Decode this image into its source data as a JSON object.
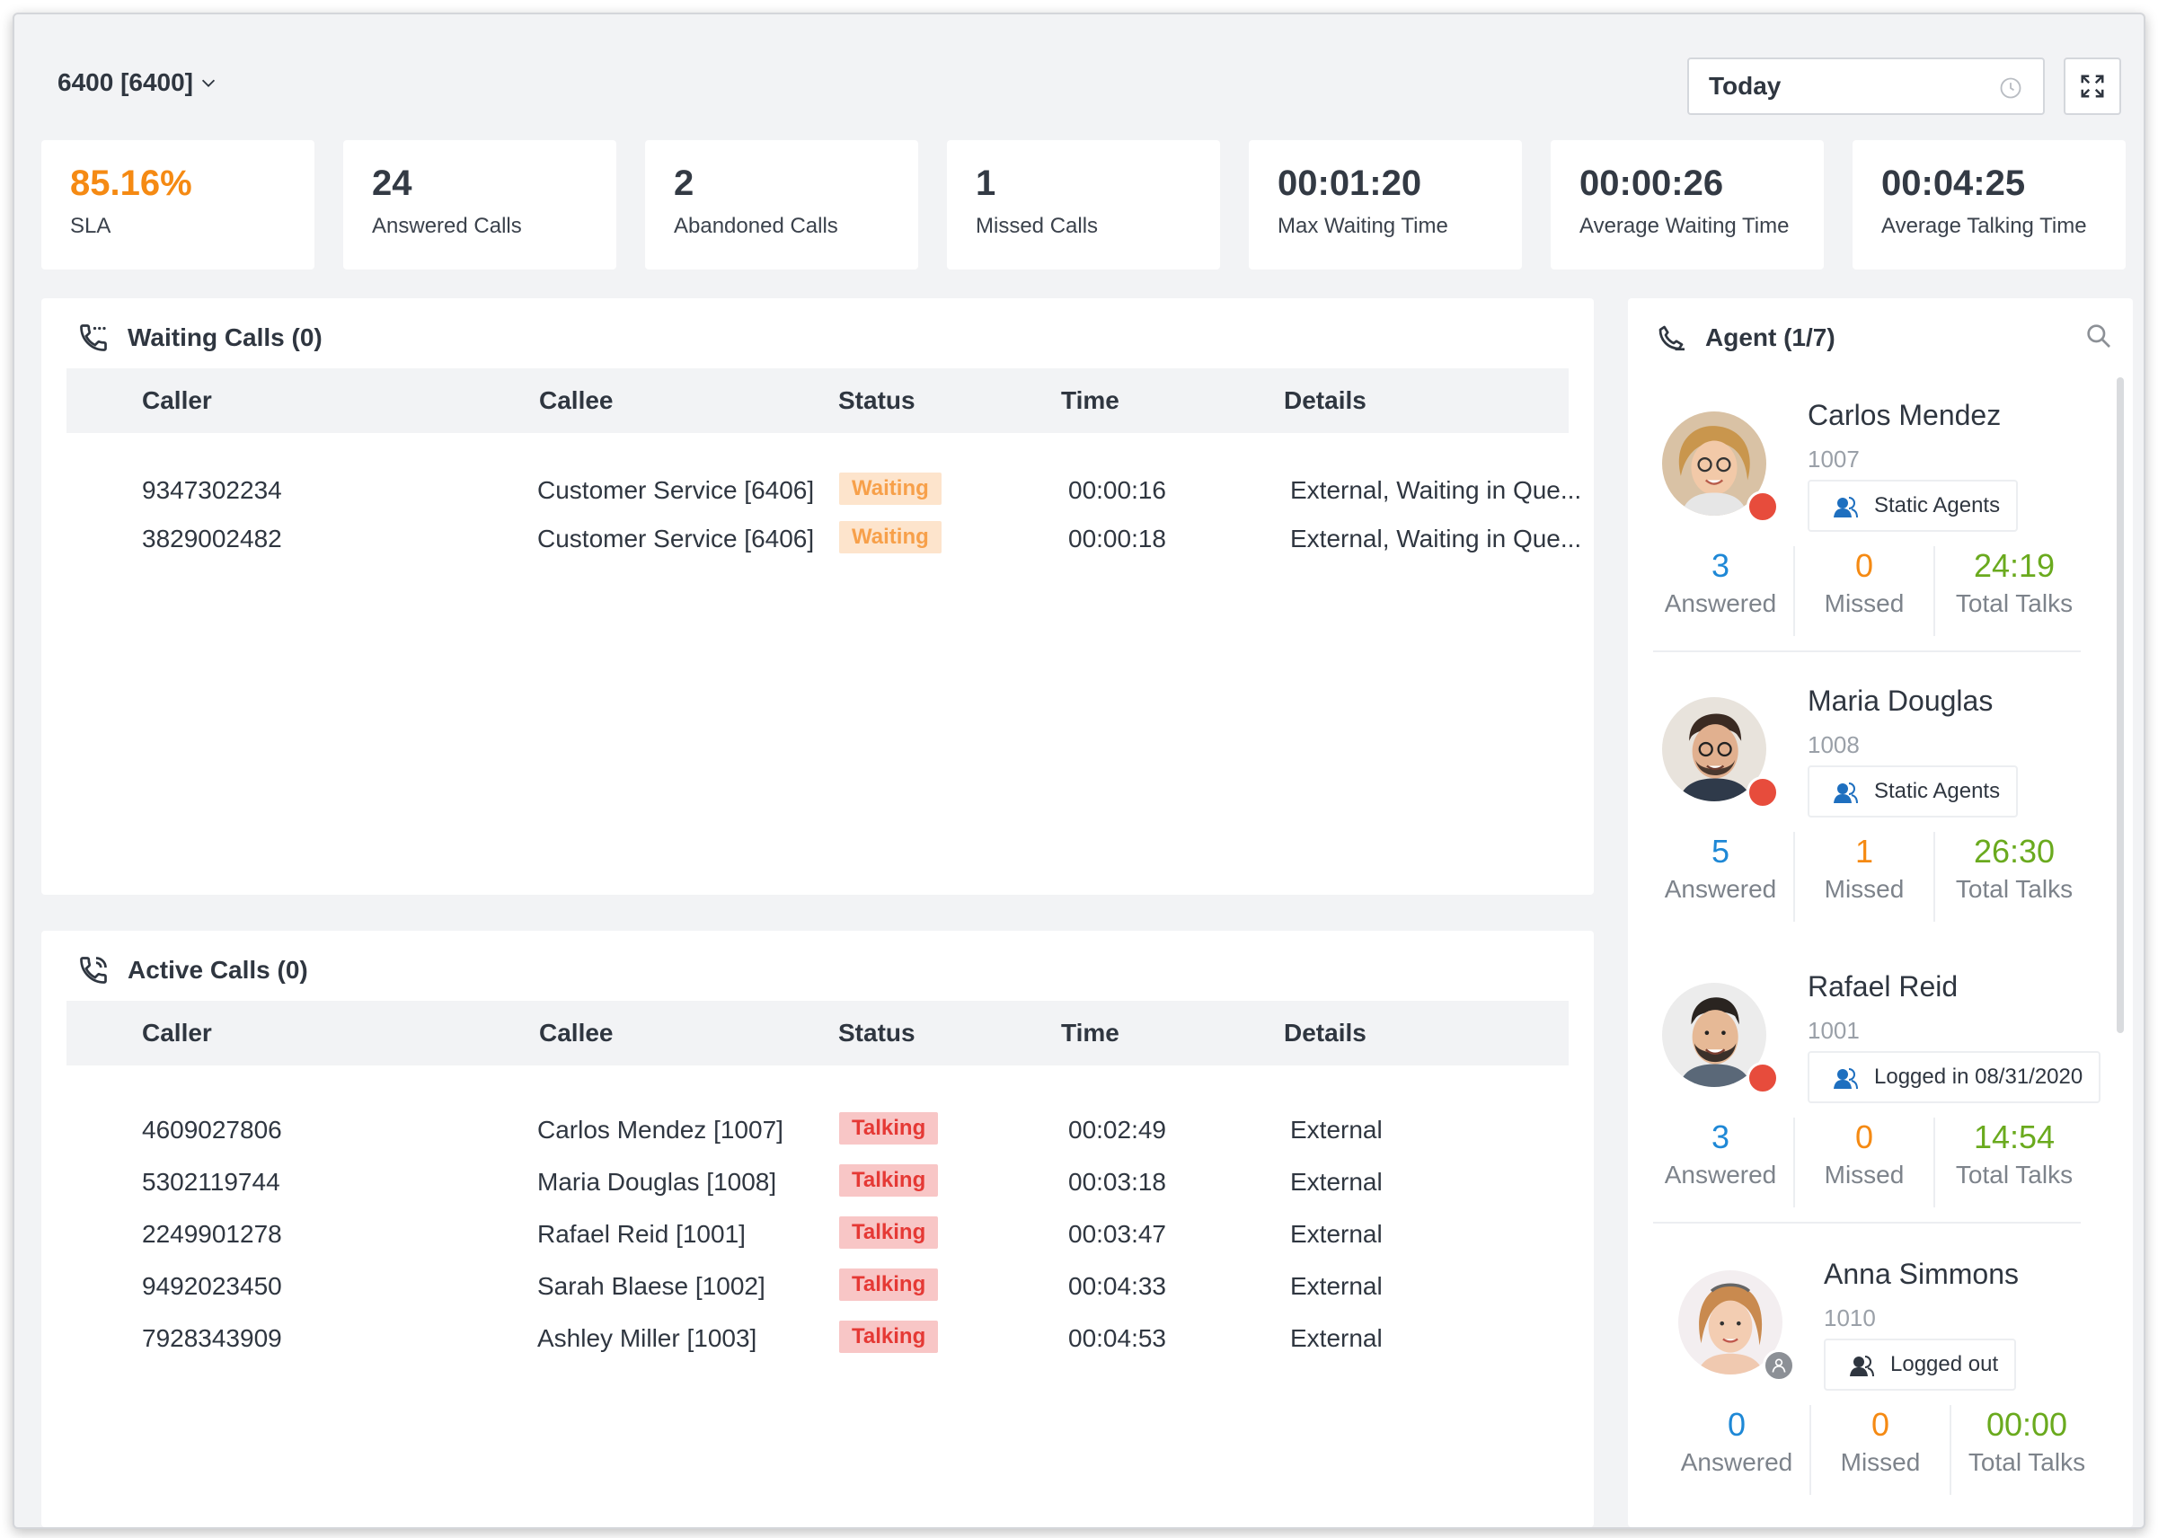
{
  "header": {
    "queue": "6400 [6400]",
    "date_range": "Today"
  },
  "stats": [
    {
      "value": "85.16%",
      "label": "SLA"
    },
    {
      "value": "24",
      "label": "Answered Calls"
    },
    {
      "value": "2",
      "label": "Abandoned Calls"
    },
    {
      "value": "1",
      "label": "Missed Calls"
    },
    {
      "value": "00:01:20",
      "label": "Max Waiting Time"
    },
    {
      "value": "00:00:26",
      "label": "Average Waiting Time"
    },
    {
      "value": "00:04:25",
      "label": "Average Talking Time"
    }
  ],
  "columns": {
    "caller": "Caller",
    "callee": "Callee",
    "status": "Status",
    "time": "Time",
    "details": "Details"
  },
  "waiting_calls": {
    "title": "Waiting Calls (0)",
    "rows": [
      {
        "caller": "9347302234",
        "callee": "Customer Service [6406]",
        "status": "Waiting",
        "time": "00:00:16",
        "details": "External, Waiting in Que..."
      },
      {
        "caller": "3829002482",
        "callee": "Customer Service [6406]",
        "status": "Waiting",
        "time": "00:00:18",
        "details": "External, Waiting in Que..."
      }
    ]
  },
  "active_calls": {
    "title": "Active Calls (0)",
    "rows": [
      {
        "caller": "4609027806",
        "callee": "Carlos Mendez [1007]",
        "status": "Talking",
        "time": "00:02:49",
        "details": "External"
      },
      {
        "caller": "5302119744",
        "callee": "Maria Douglas [1008]",
        "status": "Talking",
        "time": "00:03:18",
        "details": "External"
      },
      {
        "caller": "2249901278",
        "callee": "Rafael Reid [1001]",
        "status": "Talking",
        "time": "00:03:47",
        "details": "External"
      },
      {
        "caller": "9492023450",
        "callee": "Sarah Blaese [1002]",
        "status": "Talking",
        "time": "00:04:33",
        "details": "External"
      },
      {
        "caller": "7928343909",
        "callee": "Ashley Miller [1003]",
        "status": "Talking",
        "time": "00:04:53",
        "details": "External"
      }
    ]
  },
  "agents": {
    "title": "Agent (1/7)",
    "stat_labels": {
      "answered": "Answered",
      "missed": "Missed",
      "total": "Total Talks"
    },
    "list": [
      {
        "name": "Carlos Mendez",
        "ext": "1007",
        "role": "Static Agents",
        "answered": "3",
        "missed": "0",
        "total": "24:19",
        "status": "busy"
      },
      {
        "name": "Maria Douglas",
        "ext": "1008",
        "role": "Static Agents",
        "answered": "5",
        "missed": "1",
        "total": "26:30",
        "status": "busy"
      },
      {
        "name": "Rafael Reid",
        "ext": "1001",
        "role": "Logged in 08/31/2020",
        "answered": "3",
        "missed": "0",
        "total": "14:54",
        "status": "busy"
      },
      {
        "name": "Anna Simmons",
        "ext": "1010",
        "role": "Logged out",
        "answered": "0",
        "missed": "0",
        "total": "00:00",
        "status": "offline"
      }
    ]
  },
  "colors": {
    "accent_orange": "#f58a13",
    "answered_blue": "#1e88d6",
    "total_green": "#6aaa1e",
    "busy_red": "#e74c3c",
    "waiting_badge": "#fde4cc",
    "talking_badge": "#f8c6c6"
  },
  "icons": {
    "queue_dropdown": "chevron-down-icon",
    "date": "clock-icon",
    "fullscreen": "fullscreen-icon",
    "waiting": "phone-waiting-icon",
    "active": "phone-active-icon",
    "agent": "phone-agent-icon",
    "search": "search-icon",
    "role": "users-icon"
  }
}
